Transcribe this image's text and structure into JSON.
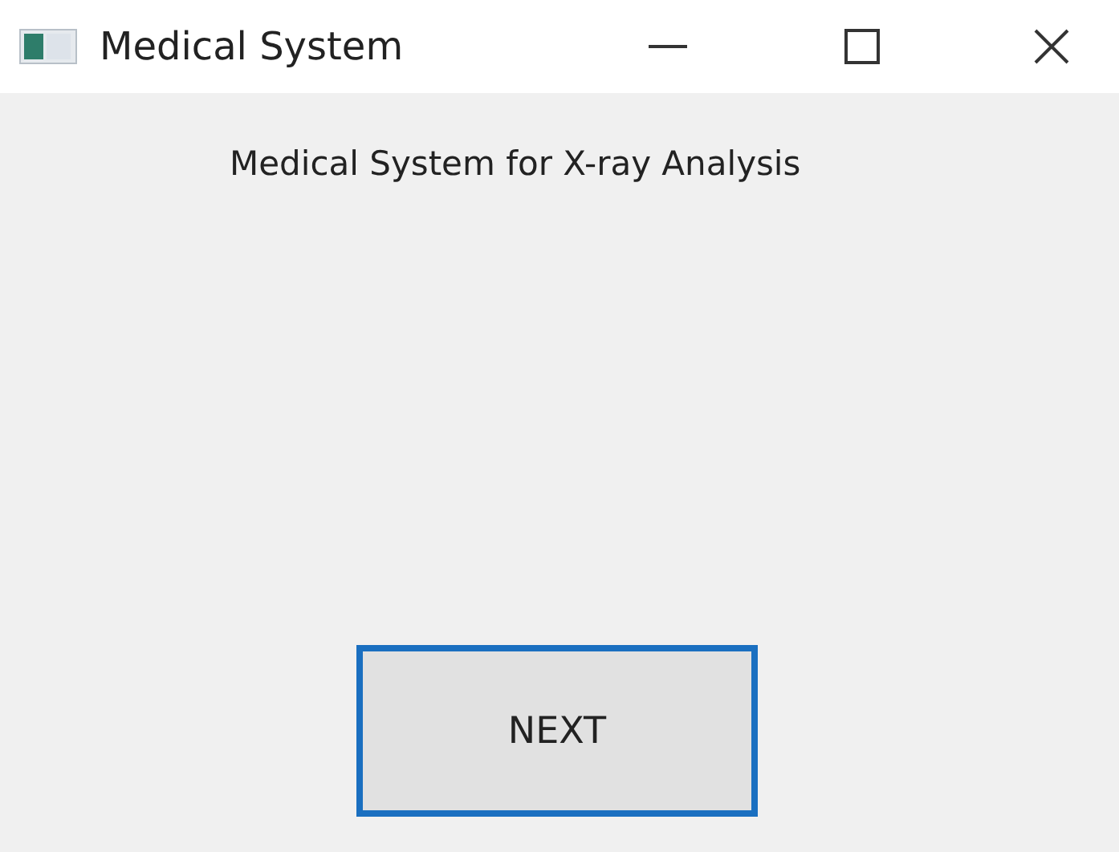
{
  "window": {
    "title": "Medical System"
  },
  "heading": "Medical System for X-ray Analysis",
  "buttons": [
    {
      "label": "NEXT",
      "focused": true
    }
  ]
}
